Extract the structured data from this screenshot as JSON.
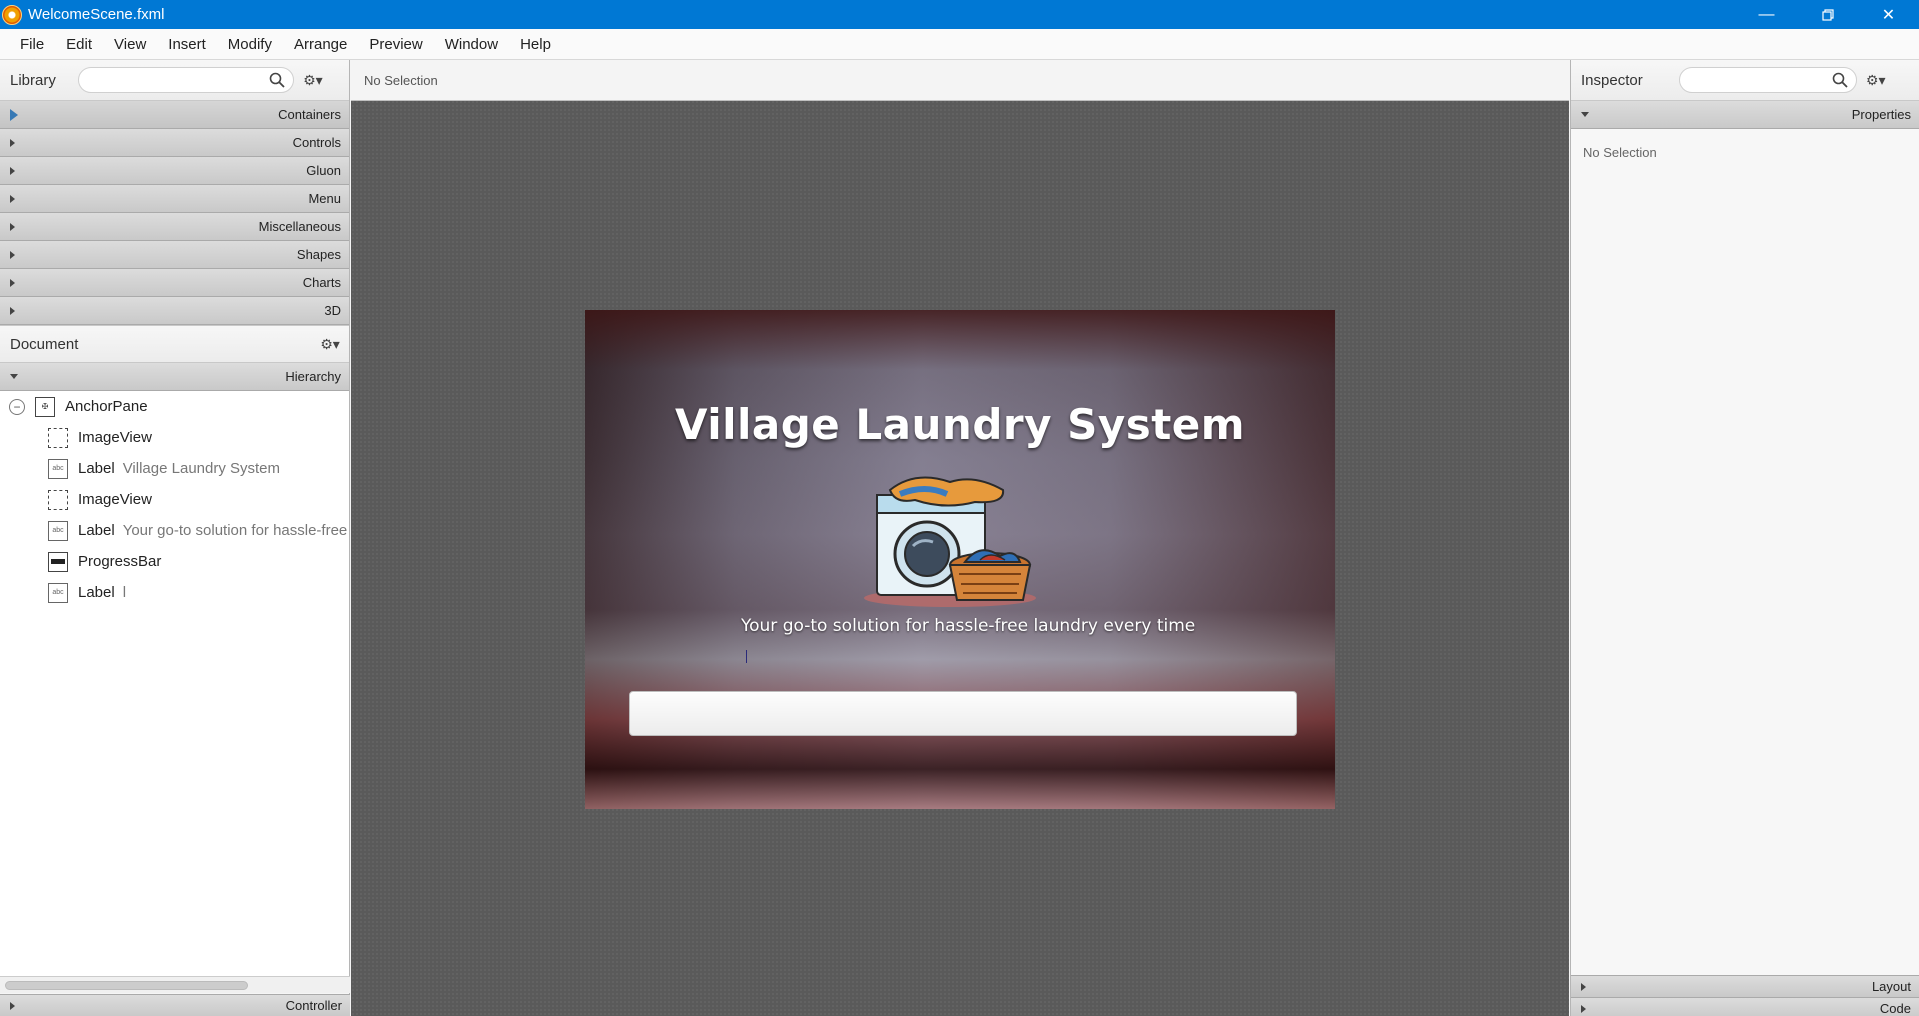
{
  "window": {
    "title": "WelcomeScene.fxml"
  },
  "menu": [
    "File",
    "Edit",
    "View",
    "Insert",
    "Modify",
    "Arrange",
    "Preview",
    "Window",
    "Help"
  ],
  "library": {
    "title": "Library",
    "search_placeholder": "",
    "sections": [
      "Containers",
      "Controls",
      "Gluon",
      "Menu",
      "Miscellaneous",
      "Shapes",
      "Charts",
      "3D"
    ]
  },
  "document": {
    "title": "Document",
    "hierarchy_label": "Hierarchy",
    "controller_label": "Controller",
    "tree": [
      {
        "type": "AnchorPane",
        "detail": "",
        "icon": "anchorpane-icon"
      },
      {
        "type": "ImageView",
        "detail": "",
        "icon": "imageview-icon"
      },
      {
        "type": "Label",
        "detail": "Village Laundry System",
        "icon": "label-icon"
      },
      {
        "type": "ImageView",
        "detail": "",
        "icon": "imageview-icon"
      },
      {
        "type": "Label",
        "detail": "Your go-to solution for hassle-free laundry every time",
        "icon": "label-icon"
      },
      {
        "type": "ProgressBar",
        "detail": "",
        "icon": "progressbar-icon"
      },
      {
        "type": "Label",
        "detail": "l",
        "icon": "label-icon"
      }
    ]
  },
  "canvas": {
    "status": "No Selection",
    "scene": {
      "title": "Village Laundry System",
      "subtitle": "Your go-to solution for hassle-free laundry every time",
      "progress": 0
    }
  },
  "inspector": {
    "title": "Inspector",
    "search_placeholder": "",
    "properties_label": "Properties",
    "selection_text": "No Selection",
    "layout_label": "Layout",
    "code_label": "Code"
  },
  "colors": {
    "titlebar": "#0078d4",
    "progress_fill": "#3b8ee0"
  }
}
